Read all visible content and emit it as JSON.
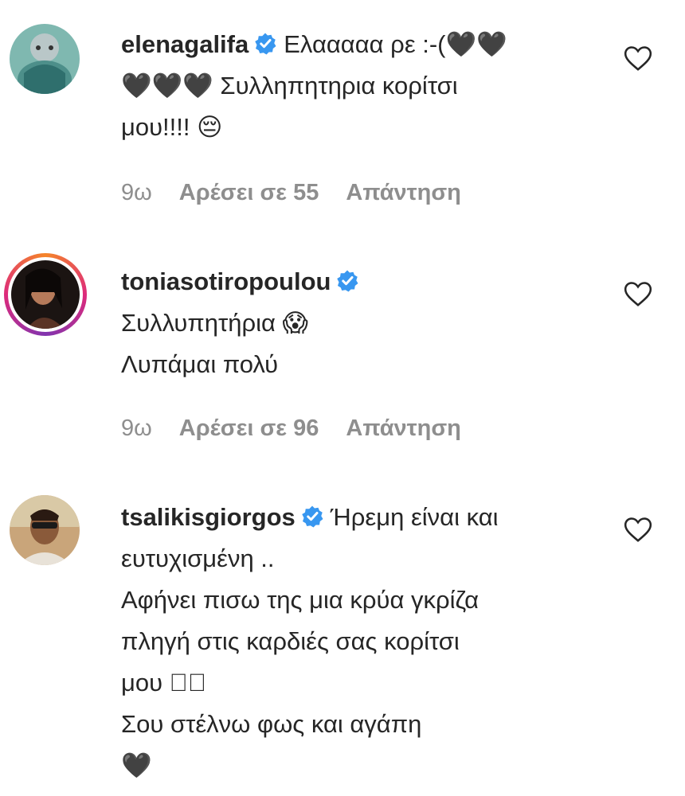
{
  "comments": [
    {
      "username": "elenagalifa",
      "lines": [
        "Ελααααα ρε :-(🖤🖤",
        "🖤🖤🖤 Συλληπητηρια κορίτσι",
        "μου!!!! 😔"
      ],
      "time": "9ω",
      "likes": "Αρέσει σε 55",
      "reply": "Απάντηση",
      "verified": true,
      "story_ring": false
    },
    {
      "username": "toniasotiropoulou",
      "lines": [
        "",
        "Συλλυπητήρια 😱",
        "Λυπάμαι πολύ"
      ],
      "time": "9ω",
      "likes": "Αρέσει σε 96",
      "reply": "Απάντηση",
      "verified": true,
      "story_ring": true
    },
    {
      "username": "tsalikisgiorgos",
      "lines": [
        "Ήρεμη είναι και",
        "ευτυχισμένη ..",
        "Αφήνει πισω της μια κρύα γκρίζα",
        "πληγή στις καρδιές σας κορίτσι",
        "μου 􀀀􀀀",
        "Σου στέλνω φως και αγάπη",
        "🖤"
      ],
      "verified": true,
      "story_ring": false
    }
  ],
  "colors": {
    "verified_blue": "#3897f0",
    "meta_gray": "#8e8e8e",
    "text": "#262626"
  }
}
